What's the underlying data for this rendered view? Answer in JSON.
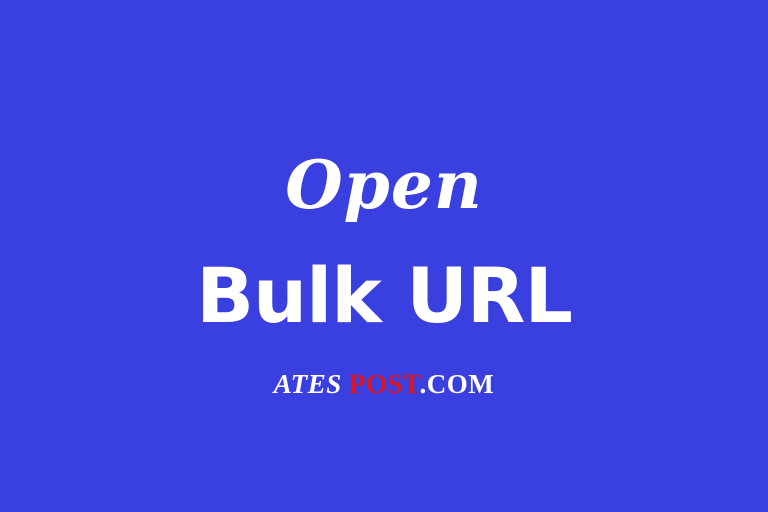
{
  "headline": {
    "open": "Open",
    "title": "Bulk URL"
  },
  "brand": {
    "part1": "ATES ",
    "part2": "POST",
    "part3": ".COM"
  },
  "colors": {
    "background": "#3a3fe0",
    "text": "#ffffff",
    "brand_accent": "#e0141e"
  }
}
